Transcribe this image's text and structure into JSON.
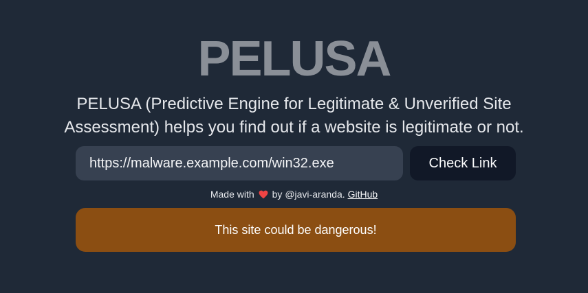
{
  "app": {
    "title": "PELUSA",
    "description": "PELUSA (Predictive Engine for Legitimate & Unverified Site Assessment) helps you find out if a website is legitimate or not."
  },
  "form": {
    "url_value": "https://malware.example.com/win32.exe",
    "check_button_label": "Check Link"
  },
  "footer": {
    "made_with": "Made with",
    "heart_icon": "heart-icon",
    "by_text": "by @javi-aranda.",
    "github_label": "GitHub"
  },
  "result": {
    "message": "This site could be dangerous!",
    "status": "warning",
    "color": "#8b4e12"
  },
  "colors": {
    "background": "#1f2937",
    "input_background": "#374151",
    "button_background": "#111827",
    "heart": "#ef4444"
  }
}
